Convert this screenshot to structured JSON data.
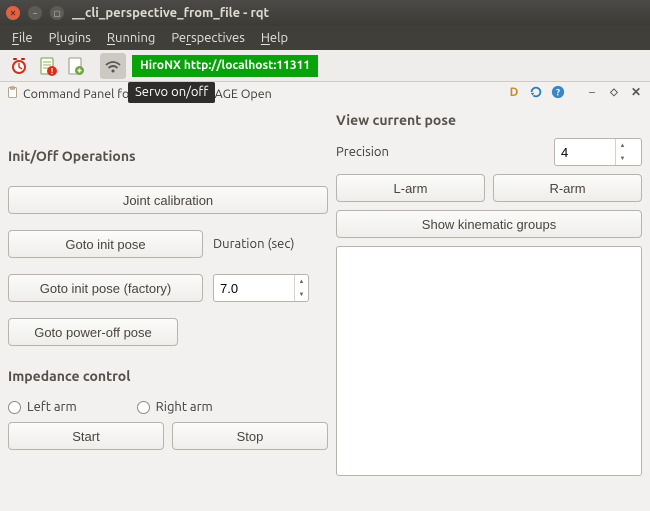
{
  "window": {
    "title": "__cli_perspective_from_file - rqt"
  },
  "menu": {
    "file": "File",
    "plugins": "Plugins",
    "running": "Running",
    "perspectives": "Perspectives",
    "help": "Help"
  },
  "toolbar": {
    "ros_label": "HiroNX http://localhost:11311"
  },
  "tabbar": {
    "label": "Command Panel for Hironx / NEXTAGE Open",
    "tooltip": "Servo on/off"
  },
  "left": {
    "header": "Init/Off Operations",
    "joint_cal": "Joint calibration",
    "goto_init": "Goto init pose",
    "duration_label": "Duration (sec)",
    "goto_factory": "Goto init pose (factory)",
    "duration_value": "7.0",
    "poweroff": "Goto power-off pose",
    "impedance_header": "Impedance control",
    "left_arm_radio": "Left arm",
    "right_arm_radio": "Right arm",
    "start": "Start",
    "stop": "Stop"
  },
  "right": {
    "header": "View current pose",
    "precision_label": "Precision",
    "precision_value": "4",
    "larm": "L-arm",
    "rarm": "R-arm",
    "kin": "Show kinematic groups"
  }
}
